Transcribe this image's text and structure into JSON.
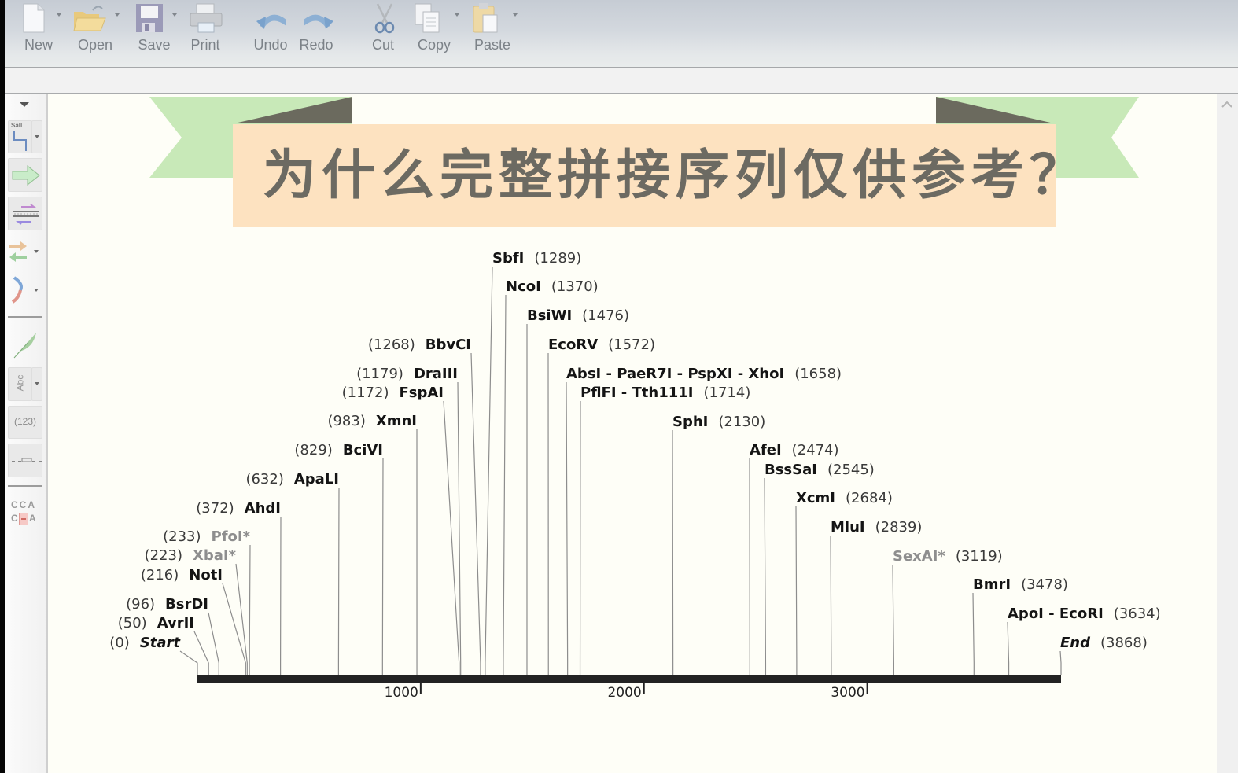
{
  "toolbar": {
    "buttons": [
      {
        "label": "New",
        "icon": "new-document-icon",
        "has_dropdown": true
      },
      {
        "label": "Open",
        "icon": "open-folder-icon",
        "has_dropdown": true
      },
      {
        "label": "Save",
        "icon": "save-disk-icon",
        "has_dropdown": true
      },
      {
        "label": "Print",
        "icon": "printer-icon",
        "has_dropdown": false
      },
      {
        "label": "Undo",
        "icon": "undo-arrow-icon",
        "has_dropdown": false
      },
      {
        "label": "Redo",
        "icon": "redo-arrow-icon",
        "has_dropdown": false
      },
      {
        "label": "Cut",
        "icon": "scissors-icon",
        "has_dropdown": false
      },
      {
        "label": "Copy",
        "icon": "copy-pages-icon",
        "has_dropdown": true
      },
      {
        "label": "Paste",
        "icon": "clipboard-icon",
        "has_dropdown": true
      }
    ]
  },
  "sidebar": {
    "collapse_icon": "triangle-down-icon",
    "tools": [
      {
        "name": "restriction-sites-tool",
        "icon": "enzyme-cut-icon",
        "text": "SalI",
        "has_dropdown": true
      },
      {
        "name": "features-tool",
        "icon": "feature-arrow-icon",
        "has_dropdown": false
      },
      {
        "name": "primers-tool",
        "icon": "primer-binding-icon",
        "has_dropdown": false
      },
      {
        "name": "orfs-tool",
        "icon": "orf-arrows-icon",
        "has_dropdown": true
      },
      {
        "name": "translations-tool",
        "icon": "arc-icon",
        "has_dropdown": true
      },
      {
        "name": "notes-tool",
        "icon": "feather-icon",
        "has_dropdown": false
      },
      {
        "name": "text-tool",
        "icon": "abc-text-icon",
        "text": "Abc",
        "has_dropdown": true
      },
      {
        "name": "numbers-tool",
        "icon": "numbers-icon",
        "text": "(123)",
        "has_dropdown": false
      },
      {
        "name": "ruler-tool",
        "icon": "ruler-icon",
        "has_dropdown": false
      },
      {
        "name": "alignment-tool",
        "icon": "mismatch-icon",
        "text_top": "CCA",
        "text_bottom_left": "C",
        "text_bottom_right": "A"
      }
    ]
  },
  "banner": {
    "title": "为什么完整拼接序列仅供参考？",
    "colors": {
      "ribbon": "#c8e9b8",
      "fold": "#6b6a5e",
      "box": "#fde2c0",
      "text": "#6c6a62"
    }
  },
  "map": {
    "sequence_length": 3868,
    "axis_ticks": [
      1000,
      2000,
      3000
    ],
    "enzymes": [
      {
        "name": "Start",
        "position": 0,
        "side": "left",
        "style": "italic"
      },
      {
        "name": "AvrII",
        "position": 50,
        "side": "left"
      },
      {
        "name": "BsrDI",
        "position": 96,
        "side": "left"
      },
      {
        "name": "NotI",
        "position": 216,
        "side": "left"
      },
      {
        "name": "XbaI*",
        "position": 223,
        "side": "left",
        "dimmed": true
      },
      {
        "name": "PfoI*",
        "position": 233,
        "side": "left",
        "dimmed": true
      },
      {
        "name": "AhdI",
        "position": 372,
        "side": "left"
      },
      {
        "name": "ApaLI",
        "position": 632,
        "side": "left"
      },
      {
        "name": "BciVI",
        "position": 829,
        "side": "left"
      },
      {
        "name": "XmnI",
        "position": 983,
        "side": "left"
      },
      {
        "name": "FspAI",
        "position": 1172,
        "side": "left"
      },
      {
        "name": "DraIII",
        "position": 1179,
        "side": "left"
      },
      {
        "name": "BbvCI",
        "position": 1268,
        "side": "left"
      },
      {
        "name": "SbfI",
        "position": 1289,
        "side": "right"
      },
      {
        "name": "NcoI",
        "position": 1370,
        "side": "right"
      },
      {
        "name": "BsiWI",
        "position": 1476,
        "side": "right"
      },
      {
        "name": "EcoRV",
        "position": 1572,
        "side": "right"
      },
      {
        "name": "AbsI - PaeR7I - PspXI - XhoI",
        "position": 1658,
        "side": "right"
      },
      {
        "name": "PflFI - Tth111I",
        "position": 1714,
        "side": "right"
      },
      {
        "name": "SphI",
        "position": 2130,
        "side": "right"
      },
      {
        "name": "AfeI",
        "position": 2474,
        "side": "right"
      },
      {
        "name": "BssSaI",
        "position": 2545,
        "side": "right"
      },
      {
        "name": "XcmI",
        "position": 2684,
        "side": "right"
      },
      {
        "name": "MluI",
        "position": 2839,
        "side": "right"
      },
      {
        "name": "SexAI*",
        "position": 3119,
        "side": "right",
        "dimmed": true
      },
      {
        "name": "BmrI",
        "position": 3478,
        "side": "right"
      },
      {
        "name": "ApoI - EcoRI",
        "position": 3634,
        "side": "right"
      },
      {
        "name": "End",
        "position": 3868,
        "side": "right",
        "style": "italic"
      }
    ]
  }
}
